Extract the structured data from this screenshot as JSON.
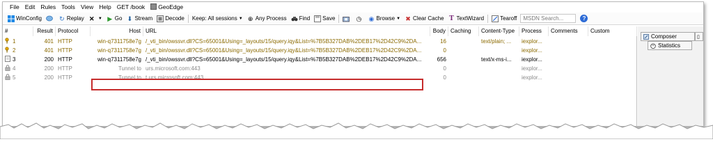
{
  "menu": {
    "items": [
      "File",
      "Edit",
      "Rules",
      "Tools",
      "View",
      "Help",
      "GET /book"
    ],
    "geoedge": "GeoEdge"
  },
  "toolbar": {
    "winconfig": "WinConfig",
    "replay": "Replay",
    "go": "Go",
    "stream": "Stream",
    "decode": "Decode",
    "keep": "Keep: All sessions",
    "any_process": "Any Process",
    "find": "Find",
    "save": "Save",
    "browse": "Browse",
    "clear_cache": "Clear Cache",
    "textwizard": "TextWizard",
    "tearoff": "Tearoff",
    "search_placeholder": "MSDN Search..."
  },
  "grid": {
    "columns": [
      "#",
      "Result",
      "Protocol",
      "Host",
      "URL",
      "Body",
      "Caching",
      "Content-Type",
      "Process",
      "Comments",
      "Custom"
    ],
    "rows": [
      {
        "num": "1",
        "result": "401",
        "protocol": "HTTP",
        "host": "win-q7311758e7g",
        "url": "/_vti_bin/owssvr.dll?CS=65001&Using=_layouts/15/query.iqy&List=%7B5B327DAB%2DEB17%2D42C9%2DA...",
        "body": "16",
        "caching": "",
        "content_type": "text/plain; ...",
        "process": "iexplor...",
        "style": "r401"
      },
      {
        "num": "2",
        "result": "401",
        "protocol": "HTTP",
        "host": "win-q7311758e7g",
        "url": "/_vti_bin/owssvr.dll?CS=65001&Using=_layouts/15/query.iqy&List=%7B5B327DAB%2DEB17%2D42C9%2DA...",
        "body": "0",
        "caching": "",
        "content_type": "",
        "process": "iexplor...",
        "style": "r401"
      },
      {
        "num": "3",
        "result": "200",
        "protocol": "HTTP",
        "host": "win-q7311758e7g",
        "url": "/_vti_bin/owssvr.dll?CS=65001&Using=_layouts/15/query.iqy&List=%7B5B327DAB%2DEB17%2D42C9%2DA...",
        "body": "656",
        "caching": "",
        "content_type": "text/x-ms-i...",
        "process": "iexplor...",
        "style": "r200"
      },
      {
        "num": "4",
        "result": "200",
        "protocol": "HTTP",
        "host": "Tunnel to",
        "url": "urs.microsoft.com:443",
        "body": "0",
        "caching": "",
        "content_type": "",
        "process": "iexplor...",
        "style": "tunnel"
      },
      {
        "num": "5",
        "result": "200",
        "protocol": "HTTP",
        "host": "Tunnel to",
        "url": "t.urs.microsoft.com:443",
        "body": "0",
        "caching": "",
        "content_type": "",
        "process": "iexplor...",
        "style": "tunnel"
      }
    ]
  },
  "right_panel": {
    "composer": "Composer",
    "statistics": "Statistics"
  }
}
